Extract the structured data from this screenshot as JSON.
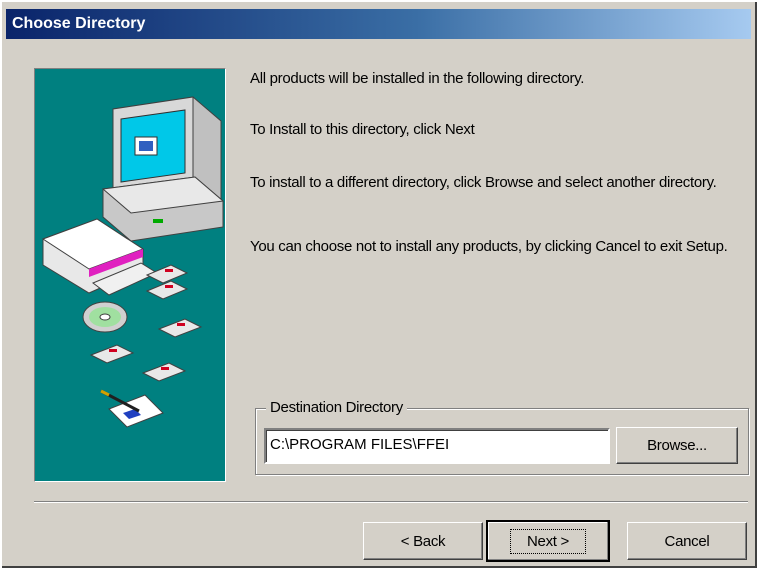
{
  "window": {
    "title": "Choose Directory"
  },
  "messages": {
    "line1": "All products will be installed in the following directory.",
    "line2": "To Install to this directory, click Next",
    "line3": "To install to a different directory, click Browse and select another directory.",
    "line4": "You can choose not to install any products, by clicking Cancel to exit Setup."
  },
  "destination": {
    "group_label": "Destination Directory",
    "path": "C:\\PROGRAM FILES\\FFEI",
    "browse_label": "Browse..."
  },
  "buttons": {
    "back": "< Back",
    "next": "Next >",
    "cancel": "Cancel"
  },
  "colors": {
    "title_start": "#0a246a",
    "title_end": "#a6caf0",
    "face": "#d4d0c8",
    "art_background": "#008080"
  },
  "icons": {
    "side_illustration": "computer-setup-illustration"
  }
}
